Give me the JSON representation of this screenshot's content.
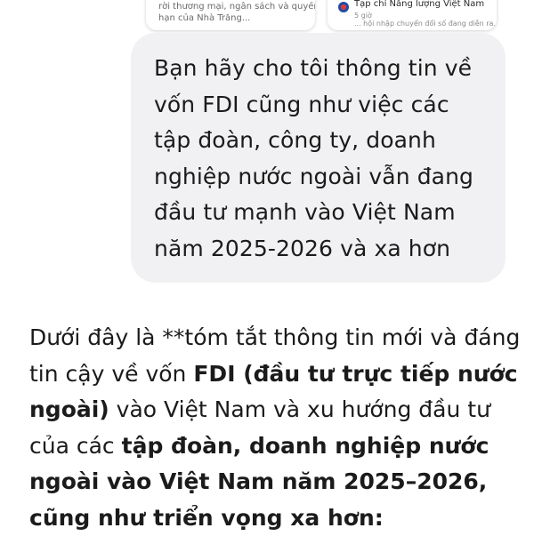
{
  "top_cards": {
    "left": {
      "line1": "rời thương mại, ngân sách và quyền",
      "line2": "hạn của Nhà Trắng..."
    },
    "right": {
      "source": "Tạp chí Năng lượng Việt Nam",
      "time": "5 giờ",
      "snippet": "... hội nhập chuyển đổi số đang diễn ra..."
    }
  },
  "user_message": "Bạn hãy cho tôi thông tin về\nvốn FDI cũng như việc các\ntập đoàn, công ty, doanh\nnghiệp nước ngoài vẫn đang\nđầu tư mạnh vào Việt Nam\nnăm 2025-2026 và xa hơn",
  "assistant_message": {
    "seg1": "Dưới đây là **tóm tắt thông tin mới và đáng tin cậy về vốn ",
    "seg2_bold": "FDI (đầu tư trực tiếp nước ngoài)",
    "seg3": " vào Việt Nam và xu hướng đầu tư của các ",
    "seg4_bold": "tập đoàn, doanh nghiệp nước ngoài vào Việt Nam năm 2025–2026, cũng như triển vọng xa hơn:"
  }
}
